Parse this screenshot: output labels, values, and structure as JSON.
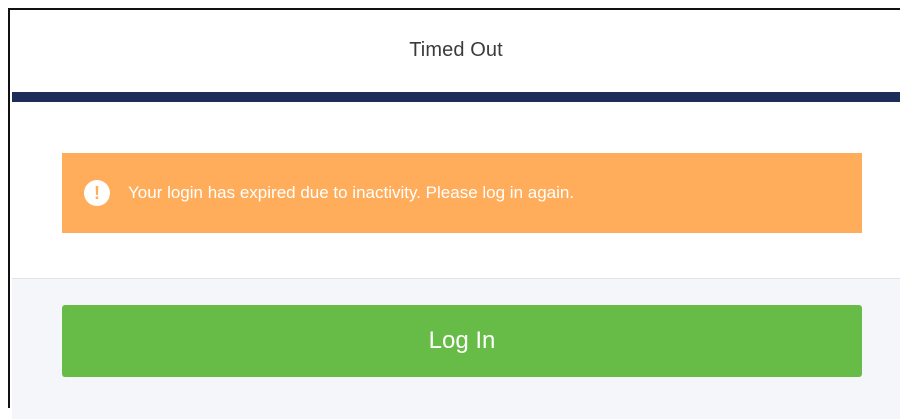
{
  "header": {
    "title": "Timed Out"
  },
  "alert": {
    "icon": "exclamation-circle-icon",
    "icon_glyph": "!",
    "message": "Your login has expired due to inactivity. Please log in again.",
    "color": "#ffad5b"
  },
  "actions": {
    "login_label": "Log In",
    "login_color": "#67bc47"
  },
  "theme": {
    "header_bar_color": "#1d2c59",
    "footer_background": "#f4f6f9"
  }
}
